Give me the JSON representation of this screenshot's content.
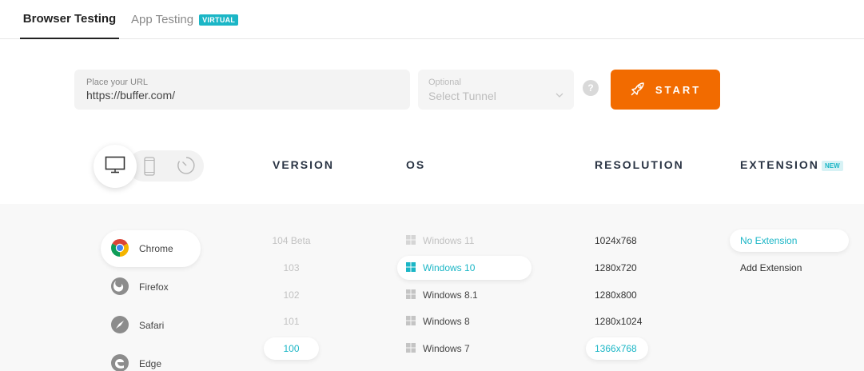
{
  "tabs": {
    "browser_testing": "Browser Testing",
    "app_testing": "App Testing",
    "virtual_badge": "VIRTUAL"
  },
  "url_field": {
    "label": "Place your URL",
    "value": "https://buffer.com/"
  },
  "tunnel_field": {
    "label": "Optional",
    "value": "Select Tunnel"
  },
  "help_icon": "?",
  "start_button": {
    "label": "START"
  },
  "headers": {
    "version": "VERSION",
    "os": "OS",
    "resolution": "RESOLUTION",
    "extension": "EXTENSION",
    "new_badge": "NEW"
  },
  "browsers": [
    {
      "name": "Chrome",
      "icon": "chrome-icon",
      "selected": true
    },
    {
      "name": "Firefox",
      "icon": "firefox-icon",
      "selected": false
    },
    {
      "name": "Safari",
      "icon": "safari-icon",
      "selected": false
    },
    {
      "name": "Edge",
      "icon": "edge-icon",
      "selected": false
    }
  ],
  "versions": [
    "104 Beta",
    "103",
    "102",
    "101",
    "100"
  ],
  "selected_version": "100",
  "os_list": [
    {
      "name": "Windows 11",
      "state": "disabled"
    },
    {
      "name": "Windows 10",
      "state": "selected"
    },
    {
      "name": "Windows 8.1",
      "state": "available"
    },
    {
      "name": "Windows 8",
      "state": "available"
    },
    {
      "name": "Windows 7",
      "state": "available"
    }
  ],
  "resolutions": [
    "1024x768",
    "1280x720",
    "1280x800",
    "1280x1024",
    "1366x768"
  ],
  "selected_resolution": "1366x768",
  "extensions": [
    {
      "name": "No Extension",
      "selected": true
    },
    {
      "name": "Add Extension",
      "selected": false
    }
  ],
  "colors": {
    "accent": "#1bb6c6",
    "start_button": "#f26b00",
    "chrome_red": "#db4437",
    "chrome_yellow": "#f4b400",
    "chrome_green": "#0f9d58",
    "chrome_blue": "#4285f4",
    "windows_selected": "#1bb6c6",
    "icon_gray": "#8c8c8c"
  }
}
